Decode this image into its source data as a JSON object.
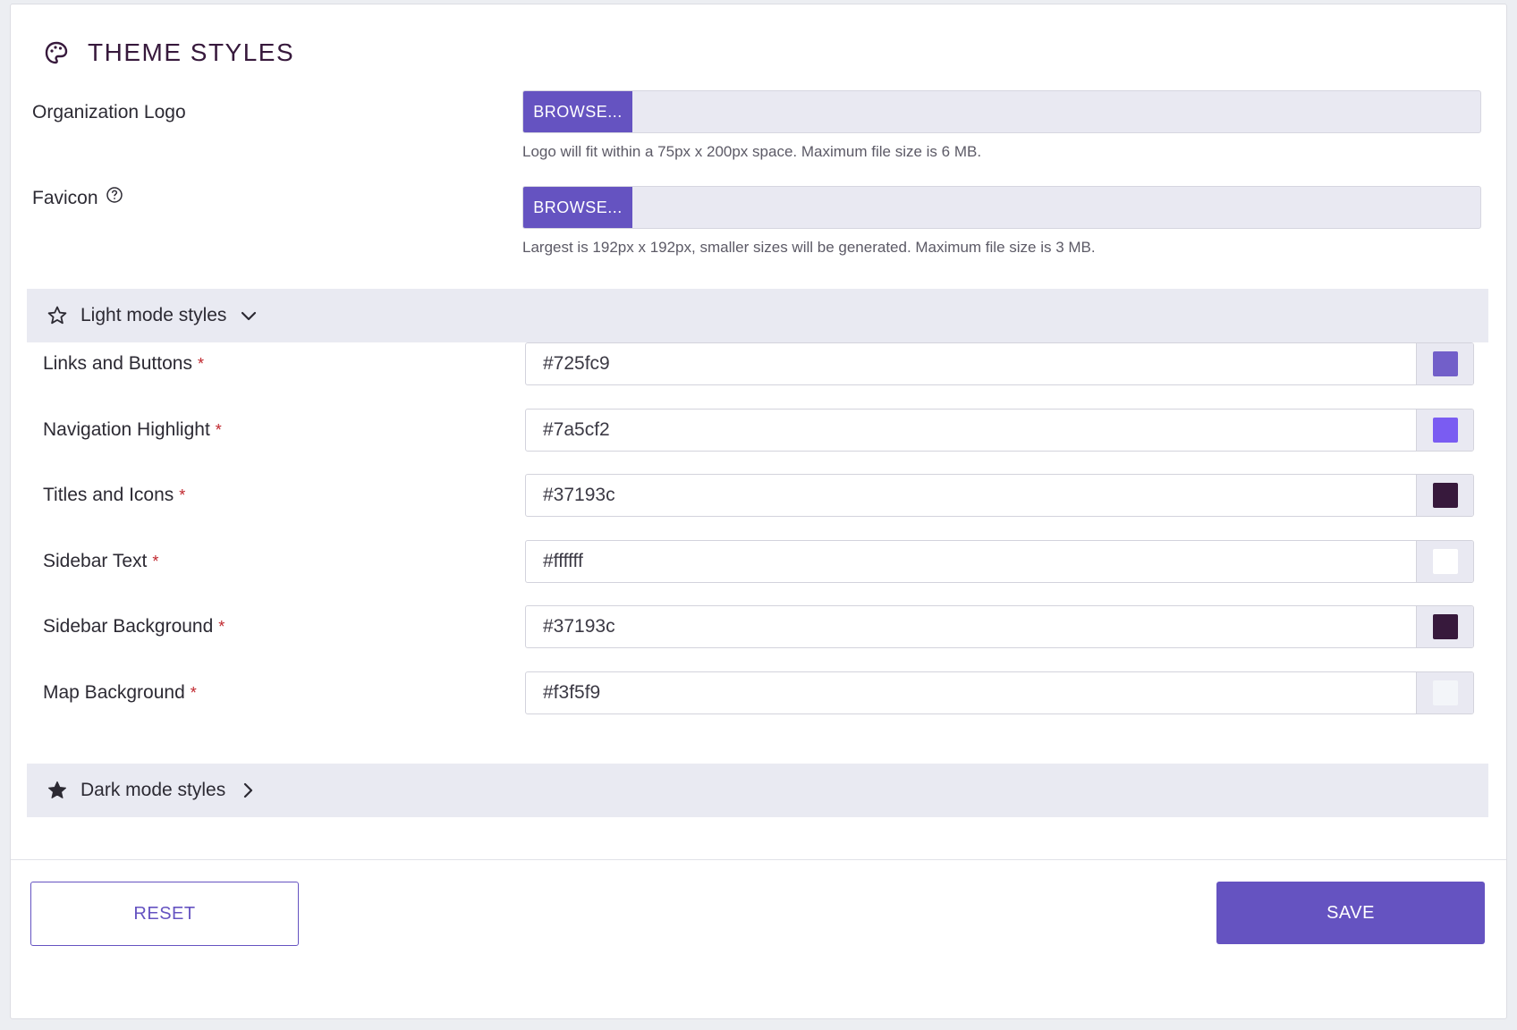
{
  "header": {
    "title": "THEME STYLES",
    "icon": "palette-icon"
  },
  "logo": {
    "label": "Organization Logo",
    "browse_label": "BROWSE...",
    "hint": "Logo will fit within a 75px x 200px space. Maximum file size is 6 MB."
  },
  "favicon": {
    "label": "Favicon",
    "help_icon": "help-circle-icon",
    "browse_label": "BROWSE...",
    "hint": "Largest is 192px x 192px, smaller sizes will be generated. Maximum file size is 3 MB."
  },
  "light_mode": {
    "label": "Light mode styles",
    "expanded": true,
    "icon": "star-outline-icon",
    "fields": [
      {
        "label": "Links and Buttons",
        "required_mark": "*",
        "value": "#725fc9",
        "color": "#725fc9"
      },
      {
        "label": "Navigation Highlight",
        "required_mark": "*",
        "value": "#7a5cf2",
        "color": "#7a5cf2"
      },
      {
        "label": "Titles and Icons",
        "required_mark": "*",
        "value": "#37193c",
        "color": "#37193c"
      },
      {
        "label": "Sidebar Text",
        "required_mark": "*",
        "value": "#ffffff",
        "color": "#ffffff"
      },
      {
        "label": "Sidebar Background",
        "required_mark": "*",
        "value": "#37193c",
        "color": "#37193c"
      },
      {
        "label": "Map Background",
        "required_mark": "*",
        "value": "#f3f5f9",
        "color": "#f3f5f9"
      }
    ]
  },
  "dark_mode": {
    "label": "Dark mode styles",
    "expanded": false,
    "icon": "star-filled-icon"
  },
  "actions": {
    "reset_label": "RESET",
    "save_label": "SAVE"
  },
  "colors": {
    "accent": "#6553c1",
    "title": "#37193c",
    "required": "#c0262d"
  }
}
